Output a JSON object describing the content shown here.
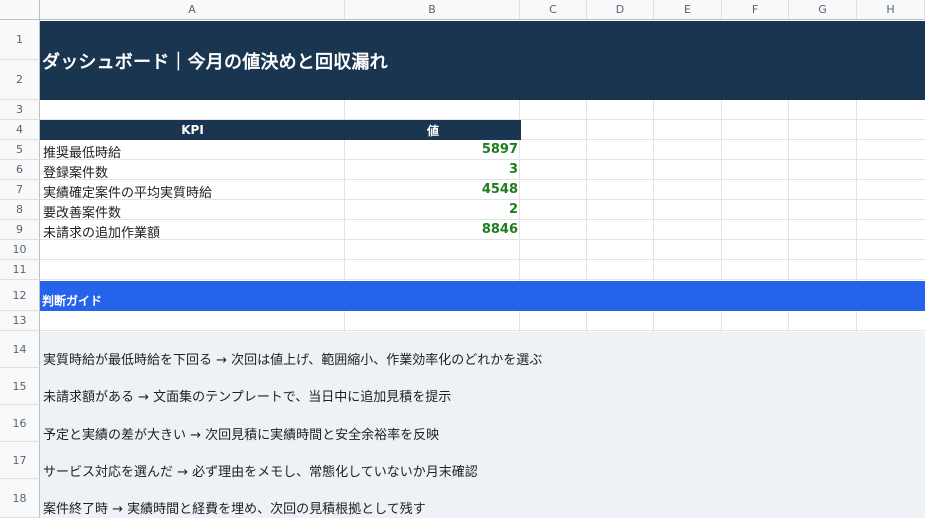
{
  "columns": [
    "A",
    "B",
    "C",
    "D",
    "E",
    "F",
    "G",
    "H"
  ],
  "rows": [
    "1",
    "2",
    "3",
    "4",
    "5",
    "6",
    "7",
    "8",
    "9",
    "10",
    "11",
    "12",
    "13",
    "14",
    "15",
    "16",
    "17",
    "18"
  ],
  "title": "ダッシュボード｜今月の値決めと回収漏れ",
  "kpi": {
    "header_label": "KPI",
    "header_value": "値",
    "items": [
      {
        "label": "推奨最低時給",
        "value": "5897"
      },
      {
        "label": "登録案件数",
        "value": "3"
      },
      {
        "label": "実績確定案件の平均実質時給",
        "value": "4548"
      },
      {
        "label": "要改善案件数",
        "value": "2"
      },
      {
        "label": "未請求の追加作業額",
        "value": "8846"
      }
    ]
  },
  "guide": {
    "title": "判断ガイド",
    "lines": [
      "実質時給が最低時給を下回る → 次回は値上げ、範囲縮小、作業効率化のどれかを選ぶ",
      "未請求額がある → 文面集のテンプレートで、当日中に追加見積を提示",
      "予定と実績の差が大きい → 次回見積に実績時間と安全余裕率を反映",
      "サービス対応を選んだ → 必ず理由をメモし、常態化していないか月末確認",
      "案件終了時 → 実績時間と経費を埋め、次回の見積根拠として残す"
    ]
  },
  "colors": {
    "title_band": "#1a3550",
    "guide_band": "#2563eb",
    "value_green": "#1e7e1e",
    "guide_bg": "#eef2f7"
  }
}
